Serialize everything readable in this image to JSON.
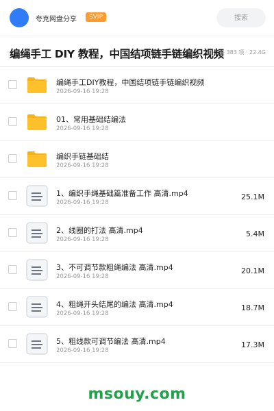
{
  "header": {
    "share_name": "夸克网盘分享",
    "badge": "SVIP",
    "search_placeholder": "搜索"
  },
  "title": "编绳手工 DIY 教程，中国结项链手链编织视频",
  "meta": "共 383 项 · 22.4G",
  "files": [
    {
      "name": "编绳手工DIY教程，中国结项链手链编织视频",
      "date": "2026-09-16 19:28",
      "size": "",
      "type": "folder"
    },
    {
      "name": "01、常用基础结编法",
      "date": "2026-09-16 19:28",
      "size": "",
      "type": "folder"
    },
    {
      "name": "编织手链基础结",
      "date": "2026-09-16 19:28",
      "size": "",
      "type": "folder"
    },
    {
      "name": "1、编织手绳基础篇准备工作 高清.mp4",
      "date": "2026-09-16 19:28",
      "size": "25.1M",
      "type": "file"
    },
    {
      "name": "2、线圈的打法 高清.mp4",
      "date": "2026-09-16 19:28",
      "size": "5.4M",
      "type": "file"
    },
    {
      "name": "3、不可调节款粗绳编法 高清.mp4",
      "date": "2026-09-16 19:28",
      "size": "20.1M",
      "type": "file"
    },
    {
      "name": "4、粗绳开头结尾的编法 高清.mp4",
      "date": "2026-09-16 19:28",
      "size": "18.7M",
      "type": "file"
    },
    {
      "name": "5、粗线款可调节编法 高清.mp4",
      "date": "2026-09-16 19:28",
      "size": "17.3M",
      "type": "file"
    }
  ],
  "watermark": "msouy.com",
  "colors": {
    "accent": "#2f7cf6",
    "svip": "#ff9a2e",
    "folder": "#ffc12b",
    "watermark": "#23a04a"
  }
}
